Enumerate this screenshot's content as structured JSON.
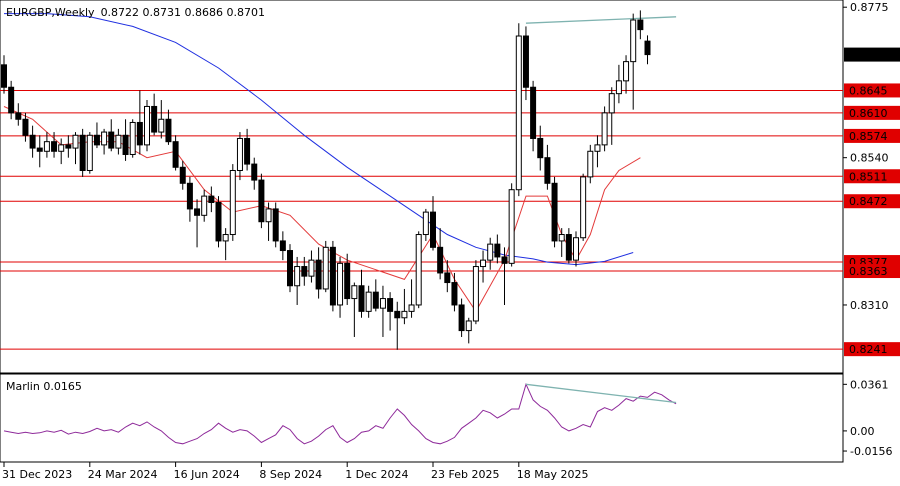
{
  "colors": {
    "background": "#ffffff",
    "frame": "#000000",
    "bull_candle": "#ffffff",
    "bear_candle": "#000000",
    "ma_slow": "#1f2fe0",
    "ma_fast": "#e33a3a",
    "levels": "#e00000",
    "trendline": "#7fb3b0",
    "oscillator": "#8e2a9a",
    "price_tag_bg": "#000000",
    "level_tag_bg": "#e00000"
  },
  "header": {
    "symbol": "EURGBP",
    "timeframe": "Weekly",
    "ohlc": "0.8722 0.8731 0.8686 0.8701"
  },
  "price_axis": {
    "ticks": [
      "0.8775",
      "0.8540",
      "0.8310"
    ],
    "current_price": "0.8701"
  },
  "levels": [
    "0.8645",
    "0.8610",
    "0.8574",
    "0.8511",
    "0.8472",
    "0.8377",
    "0.8363",
    "0.8241"
  ],
  "osc": {
    "name": "Marlin 0.0165",
    "ticks": [
      "0.0361",
      "0.00",
      "-0.0156"
    ]
  },
  "time_axis": {
    "labels": [
      "31 Dec 2023",
      "24 Mar 2024",
      "16 Jun 2024",
      "8 Sep 2024",
      "1 Dec 2024",
      "23 Feb 2025",
      "18 May 2025"
    ]
  },
  "chart_data": {
    "type": "candlestick",
    "title": "EURGBP, Weekly",
    "ylim": [
      0.821,
      0.878
    ],
    "candles": [
      [
        0.8685,
        0.87,
        0.864,
        0.865
      ],
      [
        0.865,
        0.866,
        0.86,
        0.861
      ],
      [
        0.861,
        0.8625,
        0.859,
        0.86
      ],
      [
        0.86,
        0.861,
        0.8565,
        0.8575
      ],
      [
        0.8575,
        0.859,
        0.854,
        0.8555
      ],
      [
        0.8555,
        0.8575,
        0.8525,
        0.855
      ],
      [
        0.855,
        0.858,
        0.854,
        0.8565
      ],
      [
        0.8565,
        0.858,
        0.854,
        0.855
      ],
      [
        0.855,
        0.857,
        0.853,
        0.856
      ],
      [
        0.856,
        0.8575,
        0.854,
        0.8555
      ],
      [
        0.8555,
        0.858,
        0.853,
        0.8575
      ],
      [
        0.8575,
        0.8585,
        0.851,
        0.852
      ],
      [
        0.852,
        0.858,
        0.8515,
        0.8575
      ],
      [
        0.8575,
        0.8595,
        0.8555,
        0.856
      ],
      [
        0.856,
        0.8585,
        0.8545,
        0.858
      ],
      [
        0.858,
        0.86,
        0.855,
        0.8555
      ],
      [
        0.8555,
        0.8585,
        0.8545,
        0.8575
      ],
      [
        0.8575,
        0.86,
        0.8535,
        0.8545
      ],
      [
        0.8545,
        0.86,
        0.854,
        0.8595
      ],
      [
        0.8595,
        0.8645,
        0.8545,
        0.856
      ],
      [
        0.856,
        0.863,
        0.855,
        0.862
      ],
      [
        0.862,
        0.864,
        0.8575,
        0.858
      ],
      [
        0.858,
        0.863,
        0.857,
        0.86
      ],
      [
        0.86,
        0.8615,
        0.856,
        0.8565
      ],
      [
        0.8565,
        0.8575,
        0.852,
        0.8525
      ],
      [
        0.8525,
        0.8535,
        0.849,
        0.85
      ],
      [
        0.85,
        0.851,
        0.844,
        0.846
      ],
      [
        0.846,
        0.8475,
        0.84,
        0.845
      ],
      [
        0.845,
        0.849,
        0.844,
        0.848
      ],
      [
        0.848,
        0.8495,
        0.8455,
        0.847
      ],
      [
        0.847,
        0.848,
        0.84,
        0.841
      ],
      [
        0.841,
        0.843,
        0.838,
        0.842
      ],
      [
        0.842,
        0.853,
        0.841,
        0.852
      ],
      [
        0.852,
        0.858,
        0.8505,
        0.857
      ],
      [
        0.857,
        0.8585,
        0.852,
        0.853
      ],
      [
        0.853,
        0.854,
        0.849,
        0.8505
      ],
      [
        0.8505,
        0.8515,
        0.843,
        0.844
      ],
      [
        0.844,
        0.847,
        0.841,
        0.846
      ],
      [
        0.846,
        0.847,
        0.84,
        0.841
      ],
      [
        0.841,
        0.8425,
        0.838,
        0.8395
      ],
      [
        0.8395,
        0.8405,
        0.833,
        0.834
      ],
      [
        0.834,
        0.8385,
        0.831,
        0.837
      ],
      [
        0.837,
        0.8385,
        0.834,
        0.8355
      ],
      [
        0.8355,
        0.8395,
        0.8345,
        0.838
      ],
      [
        0.838,
        0.84,
        0.832,
        0.8335
      ],
      [
        0.8335,
        0.841,
        0.833,
        0.84
      ],
      [
        0.84,
        0.841,
        0.83,
        0.831
      ],
      [
        0.831,
        0.8385,
        0.829,
        0.8375
      ],
      [
        0.8375,
        0.839,
        0.831,
        0.832
      ],
      [
        0.832,
        0.8345,
        0.826,
        0.834
      ],
      [
        0.834,
        0.8365,
        0.829,
        0.83
      ],
      [
        0.83,
        0.834,
        0.829,
        0.833
      ],
      [
        0.833,
        0.835,
        0.83,
        0.8305
      ],
      [
        0.8305,
        0.834,
        0.826,
        0.832
      ],
      [
        0.832,
        0.833,
        0.827,
        0.83
      ],
      [
        0.83,
        0.8315,
        0.824,
        0.829
      ],
      [
        0.829,
        0.8335,
        0.828,
        0.83
      ],
      [
        0.83,
        0.835,
        0.829,
        0.831
      ],
      [
        0.831,
        0.8425,
        0.8305,
        0.842
      ],
      [
        0.842,
        0.846,
        0.841,
        0.8455
      ],
      [
        0.8455,
        0.848,
        0.8395,
        0.84
      ],
      [
        0.84,
        0.843,
        0.835,
        0.836
      ],
      [
        0.836,
        0.838,
        0.833,
        0.8345
      ],
      [
        0.8345,
        0.836,
        0.83,
        0.831
      ],
      [
        0.831,
        0.832,
        0.826,
        0.827
      ],
      [
        0.827,
        0.829,
        0.825,
        0.8285
      ],
      [
        0.8285,
        0.838,
        0.828,
        0.837
      ],
      [
        0.837,
        0.8395,
        0.8345,
        0.838
      ],
      [
        0.838,
        0.8415,
        0.8365,
        0.8405
      ],
      [
        0.8405,
        0.842,
        0.8375,
        0.8385
      ],
      [
        0.8385,
        0.84,
        0.831,
        0.8375
      ],
      [
        0.8375,
        0.85,
        0.837,
        0.849
      ],
      [
        0.849,
        0.875,
        0.848,
        0.873
      ],
      [
        0.873,
        0.8745,
        0.863,
        0.865
      ],
      [
        0.865,
        0.866,
        0.855,
        0.857
      ],
      [
        0.857,
        0.859,
        0.852,
        0.854
      ],
      [
        0.854,
        0.856,
        0.849,
        0.85
      ],
      [
        0.85,
        0.851,
        0.84,
        0.841
      ],
      [
        0.841,
        0.843,
        0.8385,
        0.842
      ],
      [
        0.842,
        0.843,
        0.8375,
        0.838
      ],
      [
        0.838,
        0.8425,
        0.837,
        0.8415
      ],
      [
        0.8415,
        0.8515,
        0.841,
        0.851
      ],
      [
        0.851,
        0.856,
        0.85,
        0.855
      ],
      [
        0.855,
        0.8575,
        0.8525,
        0.856
      ],
      [
        0.856,
        0.862,
        0.855,
        0.861
      ],
      [
        0.861,
        0.865,
        0.856,
        0.864
      ],
      [
        0.864,
        0.8685,
        0.8625,
        0.866
      ],
      [
        0.866,
        0.87,
        0.864,
        0.869
      ],
      [
        0.869,
        0.8765,
        0.8615,
        0.8755
      ],
      [
        0.8755,
        0.877,
        0.8725,
        0.874
      ],
      [
        0.8722,
        0.8731,
        0.8686,
        0.8701
      ]
    ],
    "ma_slow": [
      [
        0,
        0.8765
      ],
      [
        6,
        0.8765
      ],
      [
        12,
        0.876
      ],
      [
        18,
        0.8745
      ],
      [
        24,
        0.872
      ],
      [
        30,
        0.868
      ],
      [
        36,
        0.863
      ],
      [
        42,
        0.8575
      ],
      [
        48,
        0.8525
      ],
      [
        54,
        0.848
      ],
      [
        58,
        0.845
      ],
      [
        62,
        0.842
      ],
      [
        66,
        0.84
      ],
      [
        70,
        0.8388
      ],
      [
        74,
        0.8382
      ],
      [
        76,
        0.8377
      ],
      [
        80,
        0.8373
      ],
      [
        84,
        0.8378
      ],
      [
        88,
        0.8392
      ]
    ],
    "ma_fast": [
      [
        0,
        0.862
      ],
      [
        4,
        0.86
      ],
      [
        8,
        0.856
      ],
      [
        12,
        0.8565
      ],
      [
        16,
        0.8565
      ],
      [
        20,
        0.854
      ],
      [
        24,
        0.855
      ],
      [
        28,
        0.849
      ],
      [
        32,
        0.8455
      ],
      [
        36,
        0.8465
      ],
      [
        40,
        0.845
      ],
      [
        44,
        0.8405
      ],
      [
        48,
        0.838
      ],
      [
        52,
        0.8365
      ],
      [
        56,
        0.835
      ],
      [
        60,
        0.842
      ],
      [
        63,
        0.835
      ],
      [
        66,
        0.83
      ],
      [
        70,
        0.838
      ],
      [
        73,
        0.848
      ],
      [
        76,
        0.848
      ],
      [
        78,
        0.842
      ],
      [
        80,
        0.838
      ],
      [
        82,
        0.842
      ],
      [
        84,
        0.849
      ],
      [
        86,
        0.852
      ],
      [
        89,
        0.854
      ]
    ],
    "trendline": [
      [
        73,
        0.875
      ],
      [
        94,
        0.876
      ]
    ],
    "osc_ylim": [
      -0.021,
      0.041
    ],
    "osc_trendline": [
      [
        73,
        0.0361
      ],
      [
        94,
        0.022
      ]
    ],
    "oscillator": [
      0.0,
      -0.001,
      -0.002,
      -0.001,
      -0.002,
      -0.0015,
      0.0,
      -0.001,
      0.0005,
      -0.0025,
      -0.001,
      -0.002,
      -0.0005,
      0.002,
      0.0,
      0.001,
      -0.001,
      0.003,
      0.006,
      0.004,
      0.007,
      0.003,
      0.0,
      -0.005,
      -0.009,
      -0.01,
      -0.008,
      -0.006,
      -0.002,
      0.001,
      0.006,
      0.002,
      -0.001,
      0.001,
      0.0,
      -0.004,
      -0.009,
      -0.006,
      -0.003,
      0.004,
      0.001,
      -0.006,
      -0.01,
      -0.008,
      -0.004,
      0.001,
      0.004,
      -0.005,
      -0.009,
      -0.006,
      -0.001,
      0.0,
      0.004,
      0.002,
      0.01,
      0.017,
      0.012,
      0.005,
      0.0,
      -0.006,
      -0.009,
      -0.01,
      -0.008,
      -0.005,
      0.002,
      0.006,
      0.01,
      0.016,
      0.014,
      0.01,
      0.013,
      0.017,
      0.017,
      0.0361,
      0.024,
      0.019,
      0.016,
      0.01,
      0.003,
      0.0,
      0.002,
      0.005,
      0.003,
      0.015,
      0.018,
      0.016,
      0.02,
      0.025,
      0.023,
      0.027,
      0.026,
      0.03,
      0.028,
      0.024,
      0.021
    ]
  }
}
